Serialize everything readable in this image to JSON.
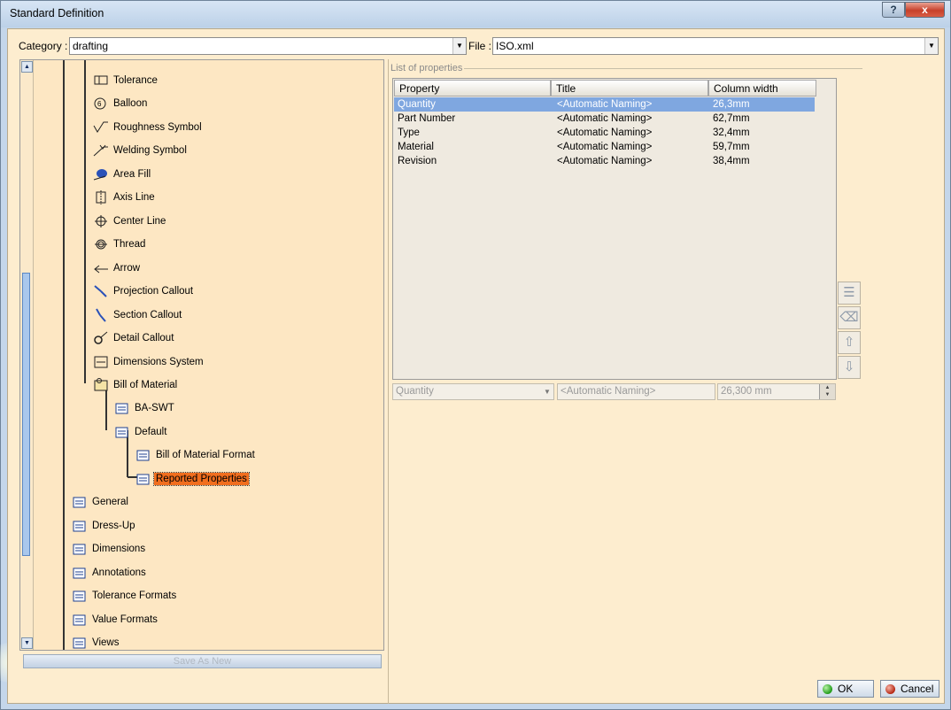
{
  "window": {
    "title": "Standard Definition",
    "help_label": "?",
    "close_label": "x"
  },
  "toolbar": {
    "category_label": "Category :",
    "category_value": "drafting",
    "file_label": "File :",
    "file_value": "ISO.xml"
  },
  "tree": {
    "items": [
      {
        "label": "Tolerance",
        "icon": "tolerance-icon"
      },
      {
        "label": "Balloon",
        "icon": "balloon-icon"
      },
      {
        "label": "Roughness Symbol",
        "icon": "roughness-symbol-icon"
      },
      {
        "label": "Welding Symbol",
        "icon": "welding-symbol-icon"
      },
      {
        "label": "Area Fill",
        "icon": "area-fill-icon"
      },
      {
        "label": "Axis Line",
        "icon": "axis-line-icon"
      },
      {
        "label": "Center Line",
        "icon": "center-line-icon"
      },
      {
        "label": "Thread",
        "icon": "thread-icon"
      },
      {
        "label": "Arrow",
        "icon": "arrow-icon"
      },
      {
        "label": "Projection Callout",
        "icon": "projection-callout-icon"
      },
      {
        "label": "Section Callout",
        "icon": "section-callout-icon"
      },
      {
        "label": "Detail Callout",
        "icon": "detail-callout-icon"
      },
      {
        "label": "Dimensions System",
        "icon": "dimensions-system-icon"
      },
      {
        "label": "Bill of Material",
        "icon": "bill-of-material-icon"
      },
      {
        "label": "BA-SWT",
        "icon": "folder-icon"
      },
      {
        "label": "Default",
        "icon": "folder-icon"
      },
      {
        "label": "Bill of Material Format",
        "icon": "folder-icon"
      },
      {
        "label": "Reported Properties",
        "icon": "folder-icon",
        "selected": true
      },
      {
        "label": "General",
        "icon": "folder-icon"
      },
      {
        "label": "Dress-Up",
        "icon": "folder-icon"
      },
      {
        "label": "Dimensions",
        "icon": "folder-icon"
      },
      {
        "label": "Annotations",
        "icon": "folder-icon"
      },
      {
        "label": "Tolerance Formats",
        "icon": "folder-icon"
      },
      {
        "label": "Value Formats",
        "icon": "folder-icon"
      },
      {
        "label": "Views",
        "icon": "folder-icon"
      }
    ],
    "save_as_new_label": "Save As New"
  },
  "properties": {
    "group_label": "List of properties",
    "columns": [
      "Property",
      "Title",
      "Column width"
    ],
    "rows": [
      {
        "property": "Quantity",
        "title": "<Automatic Naming>",
        "width": "26,3mm",
        "selected": true
      },
      {
        "property": "Part Number",
        "title": "<Automatic Naming>",
        "width": "62,7mm"
      },
      {
        "property": "Type",
        "title": "<Automatic Naming>",
        "width": "32,4mm"
      },
      {
        "property": "Material",
        "title": "<Automatic Naming>",
        "width": "59,7mm"
      },
      {
        "property": "Revision",
        "title": "<Automatic Naming>",
        "width": "38,4mm"
      }
    ],
    "edit": {
      "property_value": "Quantity",
      "title_value": "<Automatic Naming>",
      "width_value": "26,300 mm"
    }
  },
  "buttons": {
    "ok_label": "OK",
    "cancel_label": "Cancel"
  },
  "colors": {
    "selection_orange": "#f16e1e",
    "row_selection_blue": "#7fa7e0",
    "panel_bg": "#fde7c3"
  }
}
